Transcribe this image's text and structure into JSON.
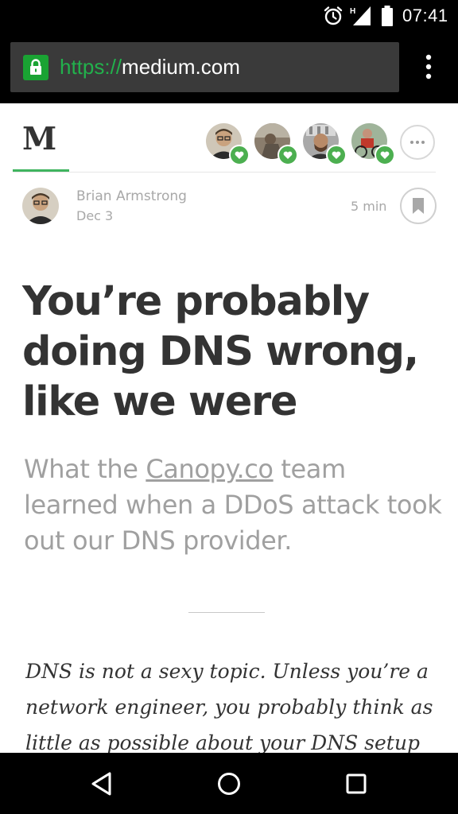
{
  "status_bar": {
    "time": "07:41",
    "network_label": "H",
    "icons": [
      "alarm-icon",
      "signal-icon",
      "battery-icon"
    ]
  },
  "browser": {
    "url_scheme": "https://",
    "url_host": "medium.com",
    "lock_color": "#1aa333",
    "scheme_color": "#22b14c",
    "menu_icon": "more-vert-icon"
  },
  "header": {
    "logo": "M",
    "accent_color": "#3fb45f",
    "followed_writers": [
      {
        "avatar": "avatar-1",
        "badge": "heart-icon"
      },
      {
        "avatar": "avatar-2",
        "badge": "heart-icon"
      },
      {
        "avatar": "avatar-3",
        "badge": "heart-icon"
      },
      {
        "avatar": "avatar-4",
        "badge": "heart-icon"
      }
    ],
    "more_icon": "more-horiz-icon"
  },
  "author": {
    "name": "Brian Armstrong",
    "date": "Dec 3",
    "read_time": "5 min",
    "bookmark_icon": "bookmark-icon"
  },
  "article": {
    "title": "You’re probably doing DNS wrong, like we were",
    "subtitle_before": "What the ",
    "subtitle_link": "Canopy.co",
    "subtitle_after": " team learned when a DDoS attack took out our DNS provider.",
    "body": "DNS is not a sexy topic. Unless you’re a network engineer, you probably think as little as possible about your DNS setup"
  },
  "nav_bar": {
    "icons": [
      "back-icon",
      "home-icon",
      "recents-icon"
    ]
  }
}
